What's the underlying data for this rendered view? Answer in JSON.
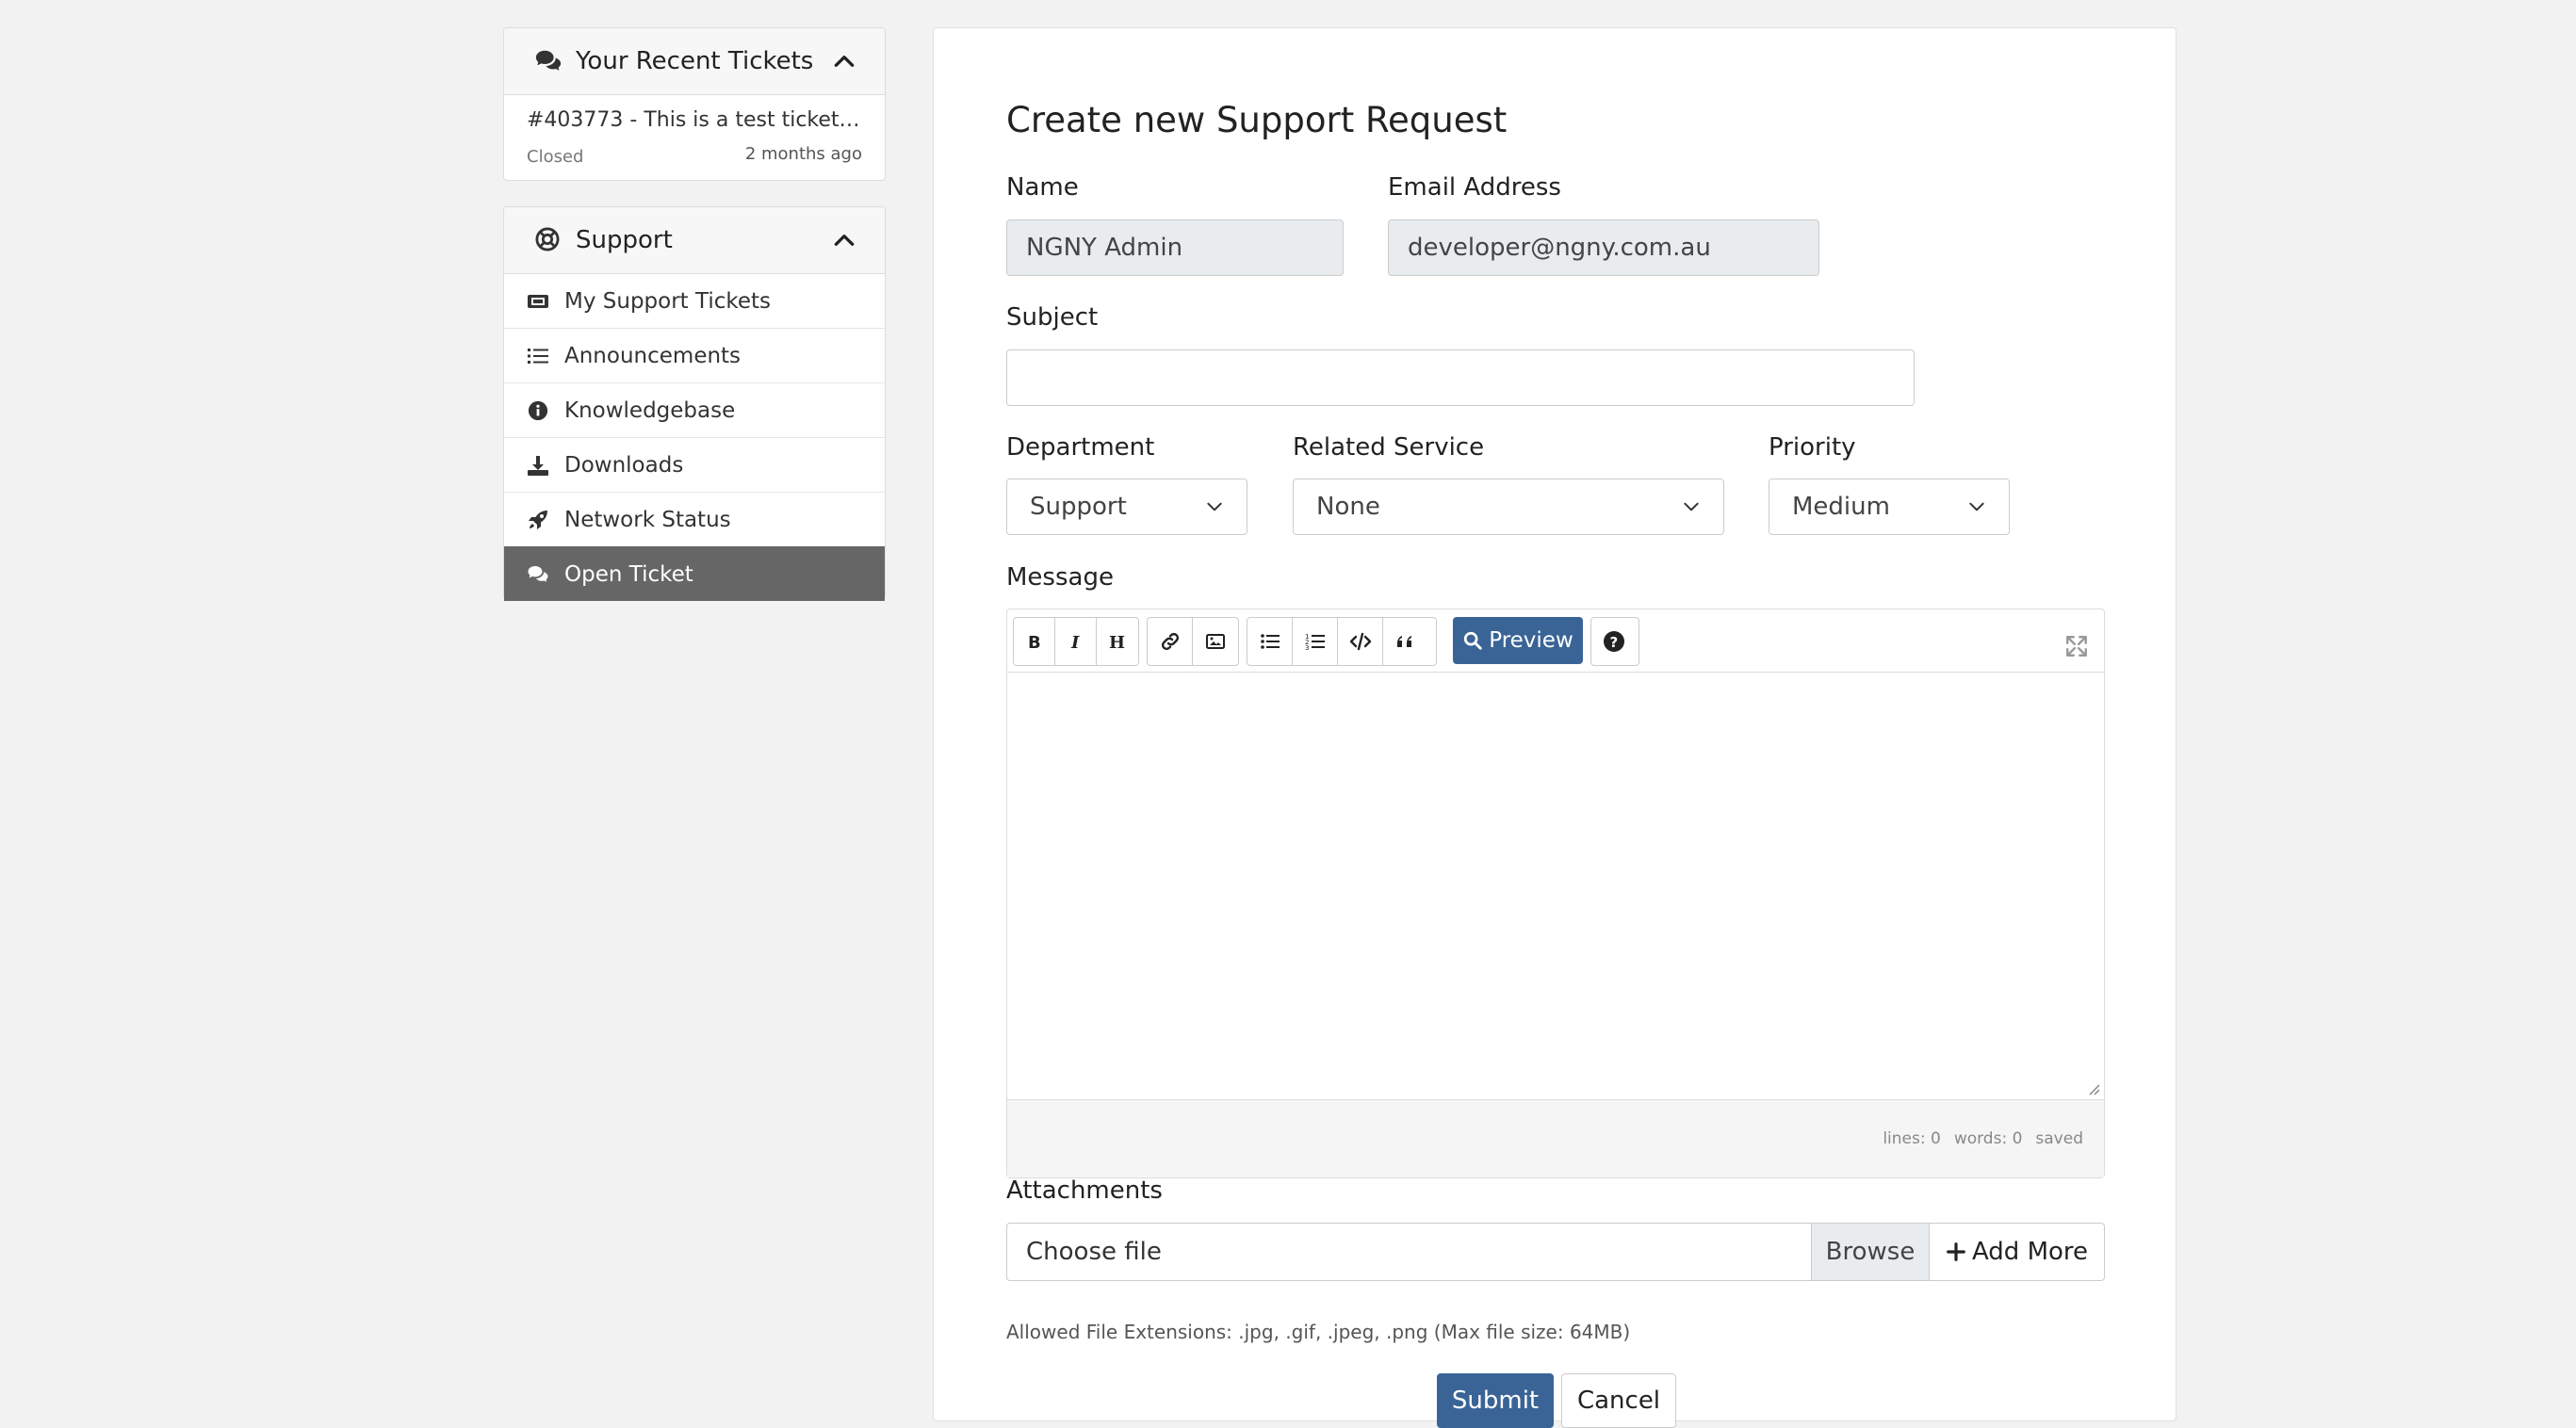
{
  "recent_tickets": {
    "title": "Your Recent Tickets",
    "items": [
      {
        "title": "#403773 - This is a test ticket to...",
        "status": "Closed",
        "time": "2 months ago"
      }
    ]
  },
  "support": {
    "title": "Support",
    "items": [
      {
        "label": "My Support Tickets",
        "icon": "ticket-icon"
      },
      {
        "label": "Announcements",
        "icon": "list-icon"
      },
      {
        "label": "Knowledgebase",
        "icon": "info-icon"
      },
      {
        "label": "Downloads",
        "icon": "download-icon"
      },
      {
        "label": "Network Status",
        "icon": "rocket-icon"
      },
      {
        "label": "Open Ticket",
        "icon": "comments-icon",
        "active": true
      }
    ]
  },
  "form": {
    "title": "Create new Support Request",
    "name_label": "Name",
    "name_value": "NGNY Admin",
    "email_label": "Email Address",
    "email_value": "developer@ngny.com.au",
    "subject_label": "Subject",
    "subject_value": "",
    "department_label": "Department",
    "department_value": "Support",
    "service_label": "Related Service",
    "service_value": "None",
    "priority_label": "Priority",
    "priority_value": "Medium",
    "message_label": "Message",
    "preview_label": "Preview",
    "status": {
      "lines": "lines: 0",
      "words": "words: 0",
      "saved": "saved"
    },
    "attachments_label": "Attachments",
    "file_placeholder": "Choose file",
    "browse_label": "Browse",
    "add_more_label": "Add More",
    "allowed_extensions": "Allowed File Extensions: .jpg, .gif, .jpeg, .png (Max file size: 64MB)",
    "submit_label": "Submit",
    "cancel_label": "Cancel"
  },
  "colors": {
    "primary": "#3a6496",
    "active_nav": "#666666",
    "readonly_bg": "#e9ecef"
  }
}
